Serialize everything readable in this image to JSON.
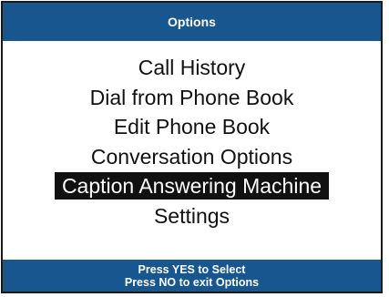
{
  "header": {
    "title": "Options"
  },
  "menu": {
    "items": [
      {
        "label": "Call History"
      },
      {
        "label": "Dial from Phone Book"
      },
      {
        "label": "Edit Phone Book"
      },
      {
        "label": "Conversation Options"
      },
      {
        "label": "Caption Answering Machine",
        "selected": true
      },
      {
        "label": "Settings"
      }
    ]
  },
  "footer": {
    "line1": "Press YES to Select",
    "line2": "Press NO to exit Options"
  },
  "colors": {
    "bar_background": "#17568f",
    "selection_background": "#111111",
    "text": "#111111"
  }
}
